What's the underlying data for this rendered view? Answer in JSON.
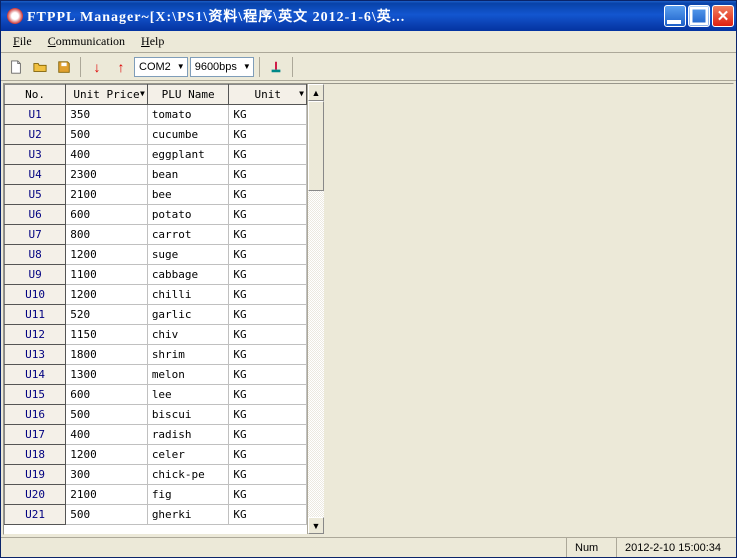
{
  "window": {
    "title": "FTPPL Manager~[X:\\PS1\\资料\\程序\\英文 2012-1-6\\英..."
  },
  "menu": {
    "file": "File",
    "communication": "Communication",
    "help": "Help"
  },
  "toolbar": {
    "com": "COM2",
    "baud": "9600bps"
  },
  "table": {
    "headers": {
      "no": "No.",
      "price": "Unit Price",
      "name": "PLU Name",
      "unit": "Unit"
    },
    "rows": [
      {
        "no": "U1",
        "price": "350",
        "name": "tomato",
        "unit": "KG"
      },
      {
        "no": "U2",
        "price": "500",
        "name": "cucumbe",
        "unit": "KG"
      },
      {
        "no": "U3",
        "price": "400",
        "name": "eggplant",
        "unit": "KG"
      },
      {
        "no": "U4",
        "price": "2300",
        "name": "bean",
        "unit": "KG"
      },
      {
        "no": "U5",
        "price": "2100",
        "name": "bee",
        "unit": "KG"
      },
      {
        "no": "U6",
        "price": "600",
        "name": "potato",
        "unit": "KG"
      },
      {
        "no": "U7",
        "price": "800",
        "name": "carrot",
        "unit": "KG"
      },
      {
        "no": "U8",
        "price": "1200",
        "name": "suge",
        "unit": "KG"
      },
      {
        "no": "U9",
        "price": "1100",
        "name": "cabbage",
        "unit": "KG"
      },
      {
        "no": "U10",
        "price": "1200",
        "name": "chilli",
        "unit": "KG"
      },
      {
        "no": "U11",
        "price": "520",
        "name": "garlic",
        "unit": "KG"
      },
      {
        "no": "U12",
        "price": "1150",
        "name": "chiv",
        "unit": "KG"
      },
      {
        "no": "U13",
        "price": "1800",
        "name": "shrim",
        "unit": "KG"
      },
      {
        "no": "U14",
        "price": "1300",
        "name": "melon",
        "unit": "KG"
      },
      {
        "no": "U15",
        "price": "600",
        "name": "lee",
        "unit": "KG"
      },
      {
        "no": "U16",
        "price": "500",
        "name": "biscui",
        "unit": "KG"
      },
      {
        "no": "U17",
        "price": "400",
        "name": "radish",
        "unit": "KG"
      },
      {
        "no": "U18",
        "price": "1200",
        "name": "celer",
        "unit": "KG"
      },
      {
        "no": "U19",
        "price": "300",
        "name": "chick-pe",
        "unit": "KG"
      },
      {
        "no": "U20",
        "price": "2100",
        "name": "fig",
        "unit": "KG"
      },
      {
        "no": "U21",
        "price": "500",
        "name": "gherki",
        "unit": "KG"
      }
    ]
  },
  "status": {
    "num": "Num",
    "datetime": "2012-2-10 15:00:34"
  }
}
